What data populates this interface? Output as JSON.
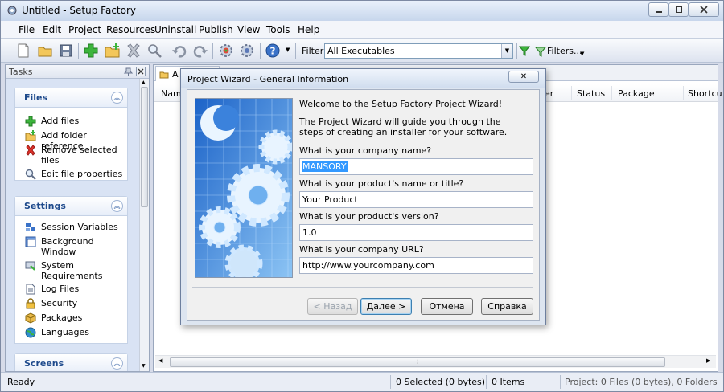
{
  "window": {
    "title": "Untitled - Setup Factory"
  },
  "menu": [
    "File",
    "Edit",
    "Project",
    "Resources",
    "Uninstall",
    "Publish",
    "View",
    "Tools",
    "Help"
  ],
  "toolbar": {
    "filter_label": "Filter:",
    "filter_value": "All Executables",
    "filters_button": "Filters..."
  },
  "tasks": {
    "title": "Tasks",
    "groups": [
      {
        "title": "Files",
        "items": [
          "Add files",
          "Add folder reference",
          "Remove selected files",
          "Edit file properties"
        ]
      },
      {
        "title": "Settings",
        "items": [
          "Session Variables",
          "Background Window",
          "System Requirements",
          "Log Files",
          "Security",
          "Packages",
          "Languages"
        ]
      },
      {
        "title": "Screens"
      }
    ]
  },
  "document": {
    "tab_label": "A",
    "columns": [
      "Name",
      "er",
      "Status",
      "Package",
      "Shortcu"
    ]
  },
  "dialog": {
    "title": "Project Wizard - General Information",
    "close_label": "✕",
    "welcome": "Welcome to the Setup Factory Project Wizard!",
    "intro": "The Project Wizard will guide you through the steps of creating an installer for your software.",
    "company_label": "What is your company name?",
    "company_value": "MANSORY",
    "product_label": "What is your product's name or title?",
    "product_value": "Your Product",
    "version_label": "What is your product's version?",
    "version_value": "1.0",
    "url_label": "What is your company URL?",
    "url_value": "http://www.yourcompany.com",
    "back_button": "< Назад",
    "next_button": "Далее >",
    "cancel_button": "Отмена",
    "help_button": "Справка"
  },
  "status": {
    "ready": "Ready",
    "selected": "0 Selected (0 bytes)",
    "items": "0 Items",
    "project": "Project: 0 Files (0 bytes), 0 Folders"
  },
  "colors": {
    "accent": "#1e4a8c",
    "selection": "#3399ff",
    "task_pane_bg": "#d9e3f4"
  }
}
